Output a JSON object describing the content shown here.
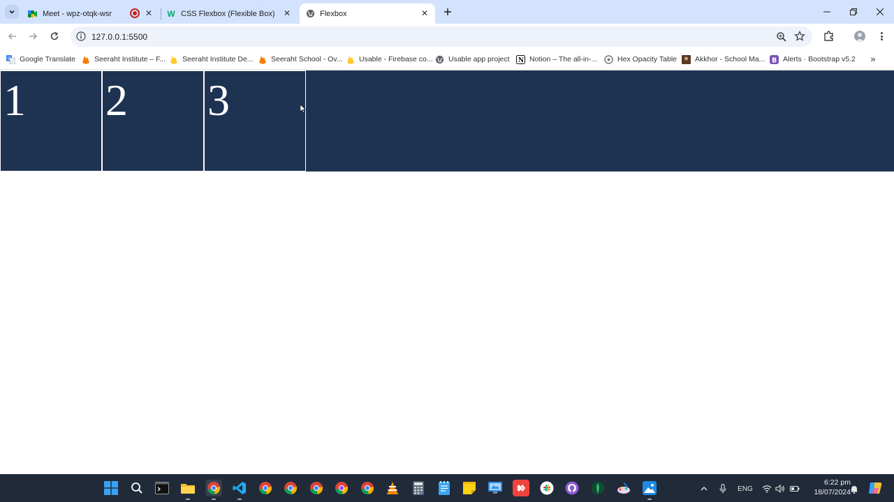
{
  "browser": {
    "tabs": [
      {
        "title": "Meet - wpz-otqk-wsr",
        "active": false,
        "recording": true
      },
      {
        "title": "CSS Flexbox (Flexible Box)",
        "active": false
      },
      {
        "title": "Flexbox",
        "active": true
      }
    ],
    "address": "127.0.0.1:5500",
    "bookmarks": [
      {
        "label": "Google Translate",
        "icon": "google-translate-icon",
        "color": "#4285f4"
      },
      {
        "label": "Seeraht Institute – F...",
        "icon": "firebase-icon",
        "color": "#f57c00"
      },
      {
        "label": "Seeraht Institute De...",
        "icon": "firebase-icon",
        "color": "#ffca28"
      },
      {
        "label": "Seeraht School - Ov...",
        "icon": "firebase-icon",
        "color": "#f57c00"
      },
      {
        "label": "Usable - Firebase co...",
        "icon": "firebase-icon",
        "color": "#ffca28"
      },
      {
        "label": "Usable app project",
        "icon": "globe-icon",
        "color": "#5f6368"
      },
      {
        "label": "Notion – The all-in-...",
        "icon": "notion-icon",
        "color": "#111111"
      },
      {
        "label": "Hex Opacity Table",
        "icon": "hex-icon",
        "color": "#777777"
      },
      {
        "label": "Akkhor - School Ma...",
        "icon": "akkhor-icon",
        "color": "#5a3a22"
      },
      {
        "label": "Alerts · Bootstrap v5.2",
        "icon": "bootstrap-icon",
        "color": "#7952b3"
      }
    ]
  },
  "page": {
    "background": "#1e3352",
    "items": [
      "1",
      "2",
      "3"
    ]
  },
  "taskbar": {
    "apps": [
      "start-icon",
      "search-icon",
      "terminal-icon",
      "file-explorer-icon",
      "chrome-icon",
      "vscode-icon",
      "chrome-icon",
      "chrome-icon",
      "chrome-icon",
      "chrome-icon",
      "chrome-icon",
      "vlc-icon",
      "calculator-icon",
      "notepad-icon",
      "sticky-notes-icon",
      "control-panel-icon",
      "anydesk-icon",
      "slack-icon",
      "github-desktop-icon",
      "mongodb-icon",
      "paint-icon",
      "photos-icon"
    ],
    "language": "ENG",
    "time": "6:22 pm",
    "date": "18/07/2024"
  }
}
